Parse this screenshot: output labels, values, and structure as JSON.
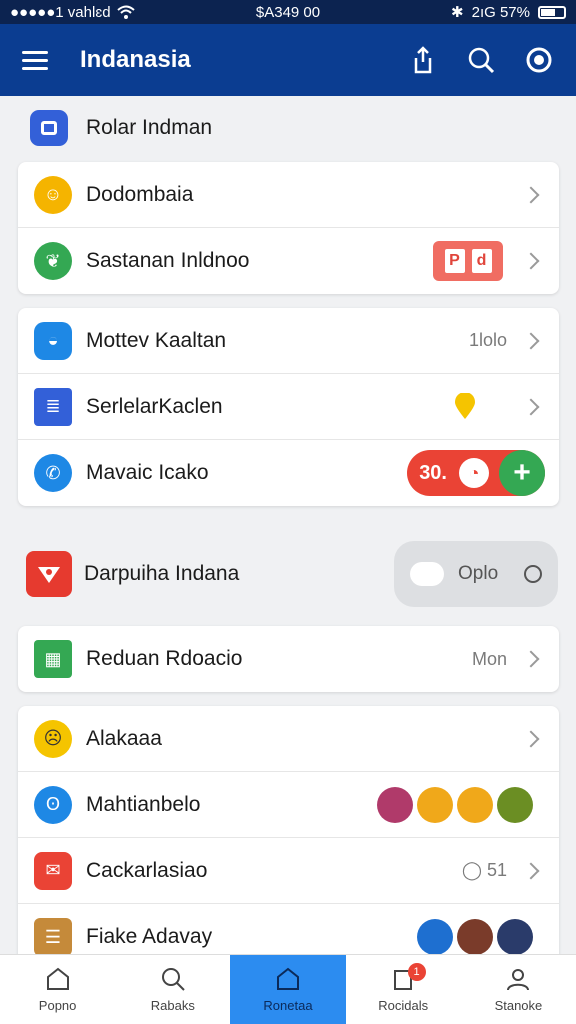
{
  "status_bar": {
    "carrier": "●●●●●1 vahlɛd",
    "time": "$A349 00",
    "battery": "2ıG 57%"
  },
  "app_bar": {
    "title": "Indanasia",
    "menu_icon": "hamburger-icon",
    "actions": [
      "share-icon",
      "search-icon",
      "profile-icon"
    ]
  },
  "section_header": {
    "label": "Rolar Indman"
  },
  "card1": [
    {
      "label": "Dodombaia",
      "icon": "avatar-icon",
      "color": "#f5b400"
    },
    {
      "label": "Sastanan Inldnoo",
      "icon": "leaf-icon",
      "color": "#34a853",
      "badge": [
        "P",
        "d"
      ]
    }
  ],
  "card2": [
    {
      "label": "Mottev Kaaltan",
      "icon": "chat-icon",
      "color": "#1e88e5",
      "value": "1lolo"
    },
    {
      "label": "SerlelarKaclen",
      "icon": "document-icon",
      "color": "#3360d8"
    },
    {
      "label": "Mavaic Icako",
      "icon": "person-icon",
      "color": "#1e88e5",
      "counter": "30."
    }
  ],
  "standalone": {
    "label": "Darpuiha Indana",
    "toggle_text": "Oplo"
  },
  "card3": [
    {
      "label": "Reduan Rdoacio",
      "icon": "grid-icon",
      "color": "#34a853",
      "value": "Mon"
    }
  ],
  "card4": [
    {
      "label": "Alakaaa",
      "icon": "emoji-icon",
      "color": "#f5c400"
    },
    {
      "label": "Mahtianbelo",
      "icon": "ghost-icon",
      "color": "#1e88e5"
    },
    {
      "label": "Cackarlasiao",
      "icon": "mail-icon",
      "color": "#ea4335",
      "value": "51"
    },
    {
      "label": "Fiake Adavay",
      "icon": "stack-icon",
      "color": "#c58a3a"
    }
  ],
  "bottom_nav": [
    {
      "label": "Popno",
      "icon": "home-outline-icon"
    },
    {
      "label": "Rabaks",
      "icon": "search-icon"
    },
    {
      "label": "Ronetaa",
      "icon": "home-icon",
      "active": true
    },
    {
      "label": "Rocidals",
      "icon": "notification-icon",
      "badge": "1"
    },
    {
      "label": "Stanoke",
      "icon": "profile-icon"
    }
  ]
}
